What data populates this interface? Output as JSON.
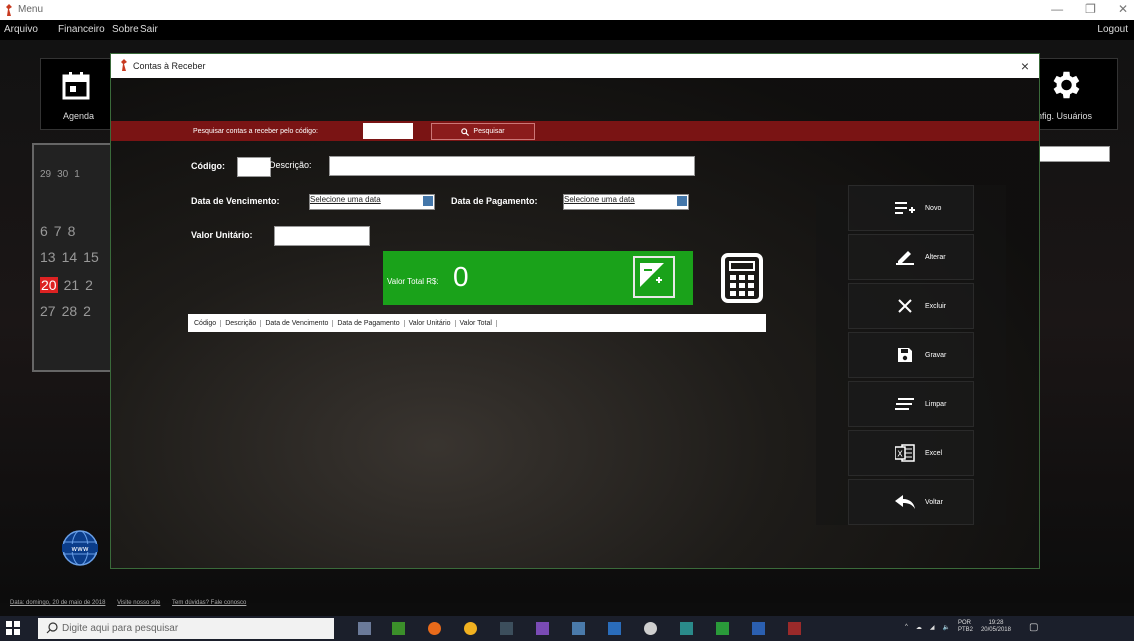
{
  "main_window": {
    "title": "Menu",
    "menu": [
      "Arquivo",
      "Financeiro",
      "Sobre",
      "Sair"
    ],
    "logout": "Logout",
    "tile_left_label": "Agenda",
    "tile_right_label": "nfig. Usuários",
    "calendar_rows": [
      [
        "29",
        "30",
        "1"
      ],
      [
        "6",
        "7",
        "8"
      ],
      [
        "13",
        "14",
        "15"
      ],
      [
        "20",
        "21",
        "2"
      ],
      [
        "27",
        "28",
        "2"
      ]
    ],
    "calendar_today": "20",
    "status_links": [
      "Data: domingo, 20 de maio de 2018",
      "Visite nosso site",
      "Tem dúvidas? Fale conosco"
    ]
  },
  "child_window": {
    "title": "Contas à Receber",
    "close_glyph": "×",
    "search": {
      "label": "Pesquisar contas a receber pelo código:",
      "value": "",
      "button_label": "Pesquisar"
    },
    "form": {
      "codigo_label": "Código:",
      "codigo_value": "",
      "descricao_label": "Descrição:",
      "descricao_value": "",
      "vencimento_label": "Data de Vencimento:",
      "vencimento_value": "Selecione uma data",
      "pagamento_label": "Data de Pagamento:",
      "pagamento_value": "Selecione uma data",
      "valor_unitario_label": "Valor Unitário:",
      "valor_unitario_value": ""
    },
    "total": {
      "label": "Valor Total R$:",
      "value": "0"
    },
    "grid_columns": [
      "Código",
      "Descrição",
      "Data de Vencimento",
      "Data de Pagamento",
      "Valor Unitário",
      "Valor Total"
    ],
    "actions": [
      {
        "label": "Novo",
        "icon": "playlist-add-icon"
      },
      {
        "label": "Alterar",
        "icon": "pencil-icon"
      },
      {
        "label": "Excluir",
        "icon": "close-icon"
      },
      {
        "label": "Gravar",
        "icon": "floppy-icon"
      },
      {
        "label": "Limpar",
        "icon": "clear-lines-icon"
      },
      {
        "label": "Excel",
        "icon": "excel-icon"
      },
      {
        "label": "Voltar",
        "icon": "reply-icon"
      }
    ]
  },
  "taskbar": {
    "search_placeholder": "Digite aqui para pesquisar",
    "lang_top": "POR",
    "lang_bottom": "PTB2",
    "time": "19:28",
    "date": "20/05/2018"
  },
  "colors": {
    "search_strip": "#7a1414",
    "total_panel": "#1aa21a",
    "calendar_today": "#dd2222"
  }
}
